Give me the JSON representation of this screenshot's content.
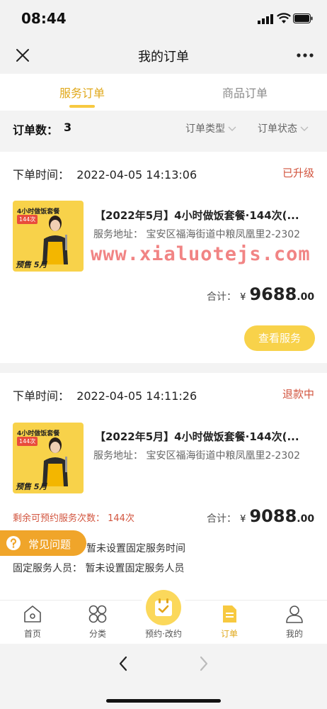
{
  "status_bar": {
    "time": "08:44"
  },
  "nav": {
    "title": "我的订单"
  },
  "tabs": [
    {
      "label": "服务订单",
      "active": true
    },
    {
      "label": "商品订单",
      "active": false
    }
  ],
  "filter": {
    "order_count_label": "订单数：",
    "order_count": "3",
    "type_label": "订单类型",
    "status_label": "订单状态"
  },
  "orders": [
    {
      "time_label": "下单时间：",
      "time": "2022-04-05 14:13:06",
      "status": "已升级",
      "thumb_title": "4小时做饭套餐",
      "thumb_badge": "144次",
      "thumb_bottom": "预售 5月",
      "product_name": "【2022年5月】4小时做饭套餐·144次(...",
      "address": "服务地址：  宝安区福海街道中粮凤凰里2-2302",
      "total_label": "合计：",
      "currency": "¥",
      "price_int": "9688",
      "price_dec": ".00",
      "action_label": "查看服务"
    },
    {
      "time_label": "下单时间：",
      "time": "2022-04-05 14:11:26",
      "status": "退款中",
      "thumb_title": "4小时做饭套餐",
      "thumb_badge": "144次",
      "thumb_bottom": "预售 5月",
      "product_name": "【2022年5月】4小时做饭套餐·144次(...",
      "address": "服务地址：  宝安区福海街道中粮凤凰里2-2302",
      "total_label": "合计：",
      "currency": "¥",
      "price_int": "9088",
      "price_dec": ".00",
      "remaining_label": "剩余可预约服务次数：  144次",
      "fixed_time": "暂未设置固定服务时间",
      "fixed_staff": "固定服务人员：  暂未设置固定服务人员"
    }
  ],
  "watermark": "www.xialuotejs.com",
  "faq": {
    "label": "常见问题"
  },
  "tabbar": [
    {
      "label": "首页",
      "icon": "home-icon"
    },
    {
      "label": "分类",
      "icon": "category-icon"
    },
    {
      "label": "预约·改约",
      "icon": "calendar-check-icon"
    },
    {
      "label": "订单",
      "icon": "order-icon",
      "active": true
    },
    {
      "label": "我的",
      "icon": "profile-icon"
    }
  ],
  "colors": {
    "accent": "#f7c940",
    "accent_text": "#e0a81a",
    "status_red": "#d2553f",
    "faq": "#f0a52a"
  }
}
